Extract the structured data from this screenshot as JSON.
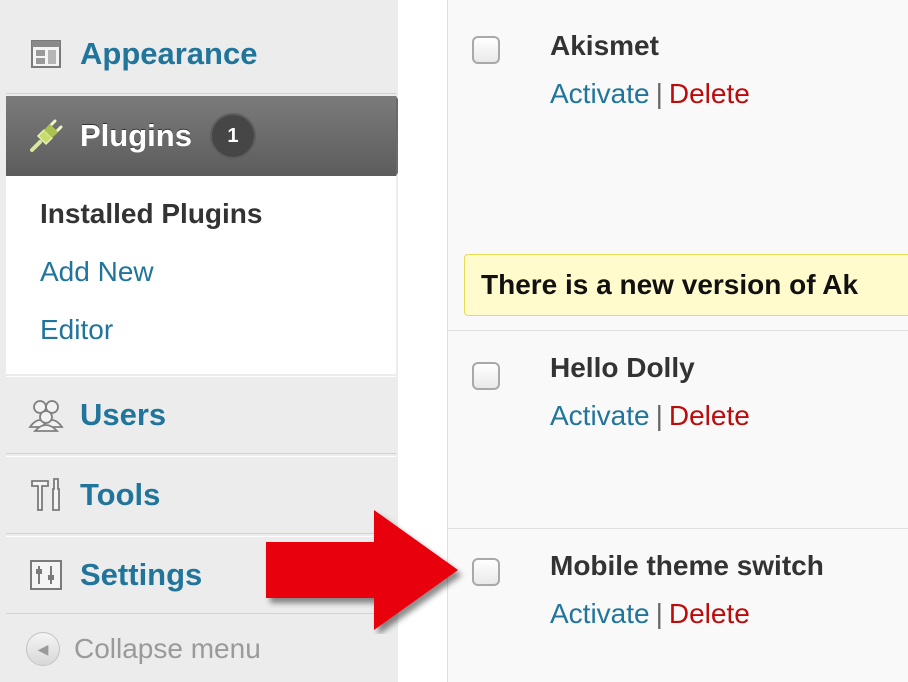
{
  "sidebar": {
    "items": [
      {
        "label": "Appearance",
        "icon": "appearance-icon"
      },
      {
        "label": "Plugins",
        "icon": "plugin-icon",
        "badge": "1"
      },
      {
        "label": "Users",
        "icon": "users-icon"
      },
      {
        "label": "Tools",
        "icon": "tools-icon"
      },
      {
        "label": "Settings",
        "icon": "settings-icon"
      }
    ],
    "submenu": [
      "Installed Plugins",
      "Add New",
      "Editor"
    ],
    "collapse_label": "Collapse menu"
  },
  "plugins": [
    {
      "name": "Akismet",
      "activate": "Activate",
      "separator": "|",
      "delete": "Delete"
    },
    {
      "name": "Hello Dolly",
      "activate": "Activate",
      "separator": "|",
      "delete": "Delete"
    },
    {
      "name": "Mobile theme switch",
      "activate": "Activate",
      "separator": "|",
      "delete": "Delete"
    }
  ],
  "update_notice": "There is a new version of Ak",
  "colors": {
    "link": "#21759b",
    "delete": "#bc0b0b",
    "active_menu": "#6a6a6a",
    "notice_bg": "#fffbcc",
    "arrow": "#e8000b"
  }
}
